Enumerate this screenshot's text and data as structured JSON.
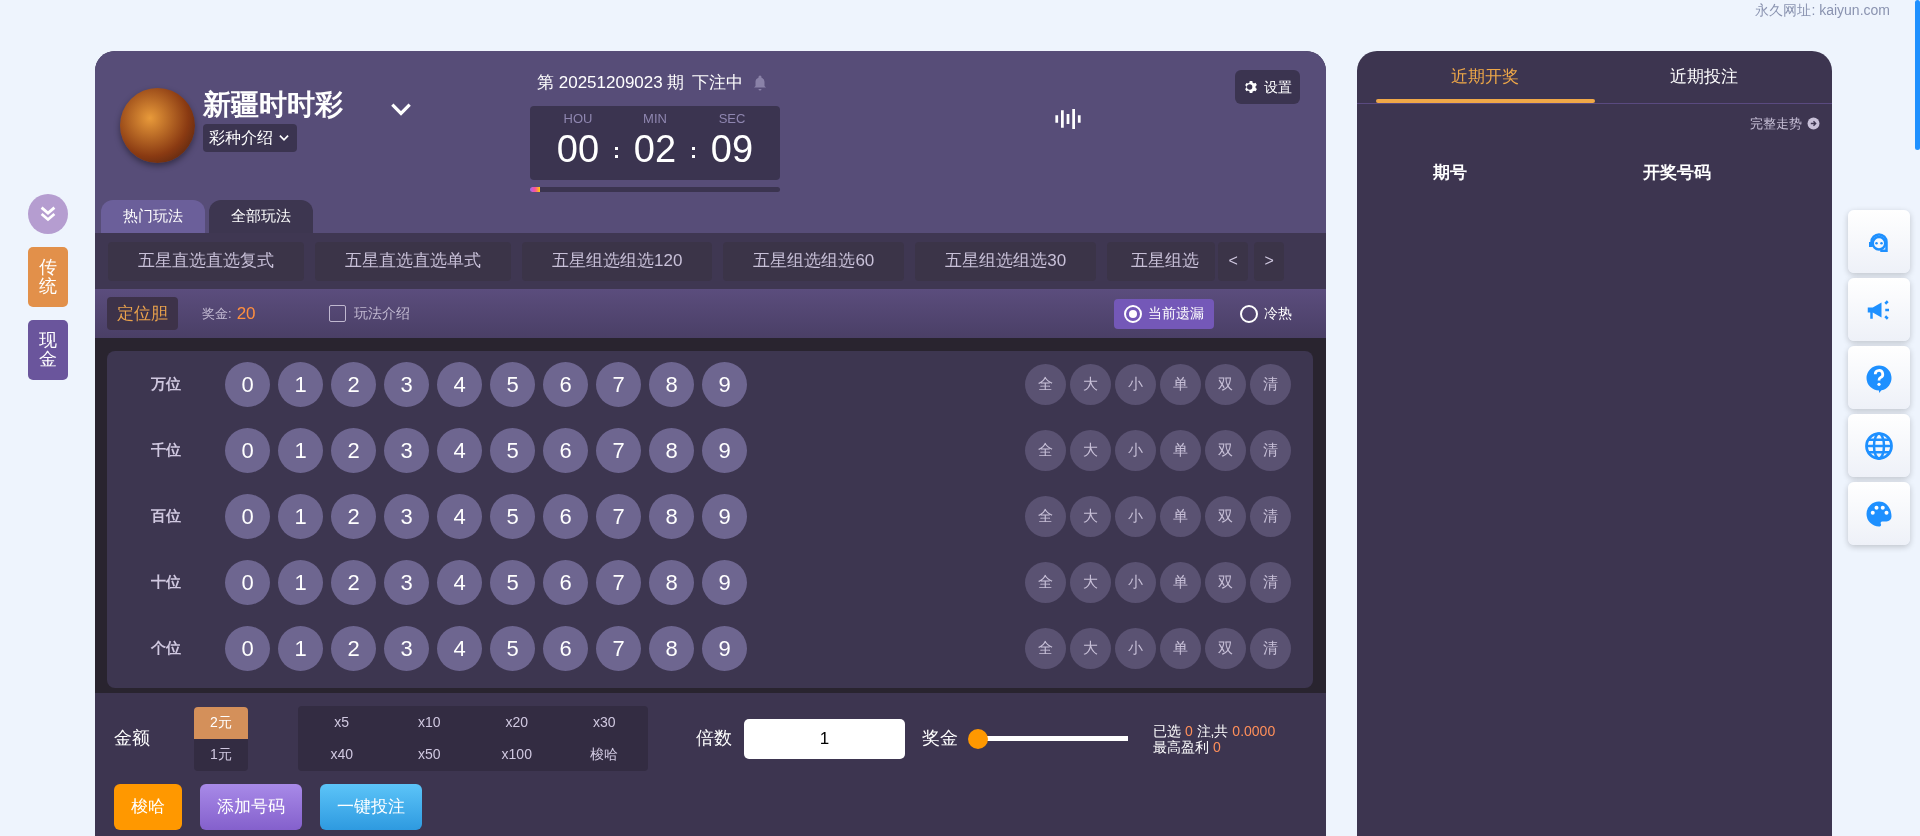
{
  "top_link": "永久网址: kaiyun.com",
  "side_tabs": [
    {
      "label": "传统",
      "color": "#e2904a"
    },
    {
      "label": "现金",
      "color": "#6a559c"
    }
  ],
  "lottery": {
    "name": "新疆时时彩",
    "intro": "彩种介绍"
  },
  "issue": {
    "prefix": "第",
    "number": "20251209023",
    "suffix": "期",
    "status": "下注中"
  },
  "countdown": {
    "units": [
      {
        "label": "HOU",
        "value": "00"
      },
      {
        "label": "MIN",
        "value": "02"
      },
      {
        "label": "SEC",
        "value": "09"
      }
    ],
    "level": 0.04
  },
  "settings": "设置",
  "play_tabs": [
    {
      "label": "热门玩法",
      "selected": true
    },
    {
      "label": "全部玩法",
      "selected": false
    }
  ],
  "plays": [
    "五星直选直选复式",
    "五星直选直选单式",
    "五星组选组选120",
    "五星组选组选60",
    "五星组选组选30",
    "五星组选"
  ],
  "play_nav": [
    "<",
    ">"
  ],
  "mode": "定位胆",
  "prize_label": "奖金:",
  "prize": "20",
  "intro_check": {
    "label": "玩法介绍",
    "checked": false
  },
  "radios": [
    {
      "label": "当前遗漏",
      "selected": true
    },
    {
      "label": "冷热",
      "selected": false
    }
  ],
  "rows": [
    {
      "label": "万位",
      "balls": [
        {
          "label": "0",
          "selected": false
        },
        {
          "label": "1",
          "selected": false
        },
        {
          "label": "2",
          "selected": false
        },
        {
          "label": "3",
          "selected": false
        },
        {
          "label": "4",
          "selected": false
        },
        {
          "label": "5",
          "selected": false
        },
        {
          "label": "6",
          "selected": false
        },
        {
          "label": "7",
          "selected": false
        },
        {
          "label": "8",
          "selected": false
        },
        {
          "label": "9",
          "selected": false
        }
      ],
      "quick": [
        "全",
        "大",
        "小",
        "单",
        "双",
        "清"
      ]
    },
    {
      "label": "千位",
      "balls": [
        {
          "label": "0",
          "selected": false
        },
        {
          "label": "1",
          "selected": false
        },
        {
          "label": "2",
          "selected": false
        },
        {
          "label": "3",
          "selected": false
        },
        {
          "label": "4",
          "selected": false
        },
        {
          "label": "5",
          "selected": false
        },
        {
          "label": "6",
          "selected": false
        },
        {
          "label": "7",
          "selected": false
        },
        {
          "label": "8",
          "selected": false
        },
        {
          "label": "9",
          "selected": false
        }
      ],
      "quick": [
        "全",
        "大",
        "小",
        "单",
        "双",
        "清"
      ]
    },
    {
      "label": "百位",
      "balls": [
        {
          "label": "0",
          "selected": false
        },
        {
          "label": "1",
          "selected": false
        },
        {
          "label": "2",
          "selected": false
        },
        {
          "label": "3",
          "selected": false
        },
        {
          "label": "4",
          "selected": false
        },
        {
          "label": "5",
          "selected": false
        },
        {
          "label": "6",
          "selected": false
        },
        {
          "label": "7",
          "selected": false
        },
        {
          "label": "8",
          "selected": false
        },
        {
          "label": "9",
          "selected": false
        }
      ],
      "quick": [
        "全",
        "大",
        "小",
        "单",
        "双",
        "清"
      ]
    },
    {
      "label": "十位",
      "balls": [
        {
          "label": "0",
          "selected": false
        },
        {
          "label": "1",
          "selected": false
        },
        {
          "label": "2",
          "selected": false
        },
        {
          "label": "3",
          "selected": false
        },
        {
          "label": "4",
          "selected": false
        },
        {
          "label": "5",
          "selected": false
        },
        {
          "label": "6",
          "selected": false
        },
        {
          "label": "7",
          "selected": false
        },
        {
          "label": "8",
          "selected": false
        },
        {
          "label": "9",
          "selected": false
        }
      ],
      "quick": [
        "全",
        "大",
        "小",
        "单",
        "双",
        "清"
      ]
    },
    {
      "label": "个位",
      "balls": [
        {
          "label": "0",
          "selected": false
        },
        {
          "label": "1",
          "selected": false
        },
        {
          "label": "2",
          "selected": false
        },
        {
          "label": "3",
          "selected": false
        },
        {
          "label": "4",
          "selected": false
        },
        {
          "label": "5",
          "selected": false
        },
        {
          "label": "6",
          "selected": false
        },
        {
          "label": "7",
          "selected": false
        },
        {
          "label": "8",
          "selected": false
        },
        {
          "label": "9",
          "selected": false
        }
      ],
      "quick": [
        "全",
        "大",
        "小",
        "单",
        "双",
        "清"
      ]
    }
  ],
  "amount_label": "金额",
  "units": [
    {
      "label": "2元",
      "selected": true
    },
    {
      "label": "1元",
      "selected": false
    }
  ],
  "multipliers": [
    "x5",
    "x10",
    "x20",
    "x30",
    "x40",
    "x50",
    "x100",
    "梭哈"
  ],
  "multiple_label": "倍数",
  "multiple_value": "1",
  "rebate_label": "奖金",
  "rebate_slider": {
    "level": 0
  },
  "summary": {
    "selected_label": "已选",
    "selected_count": "0",
    "total_label": "注,共",
    "total": "0.0000",
    "max_label": "最高盈利",
    "max": "0"
  },
  "actions": [
    {
      "label": "梭哈",
      "kind": "allin"
    },
    {
      "label": "添加号码",
      "kind": "add"
    },
    {
      "label": "一键投注",
      "kind": "bet"
    }
  ],
  "recent_tabs": [
    {
      "label": "近期开奖",
      "selected": true
    },
    {
      "label": "近期投注",
      "selected": false
    }
  ],
  "trend_link": "完整走势",
  "recent_columns": [
    "期号",
    "开奖号码"
  ]
}
